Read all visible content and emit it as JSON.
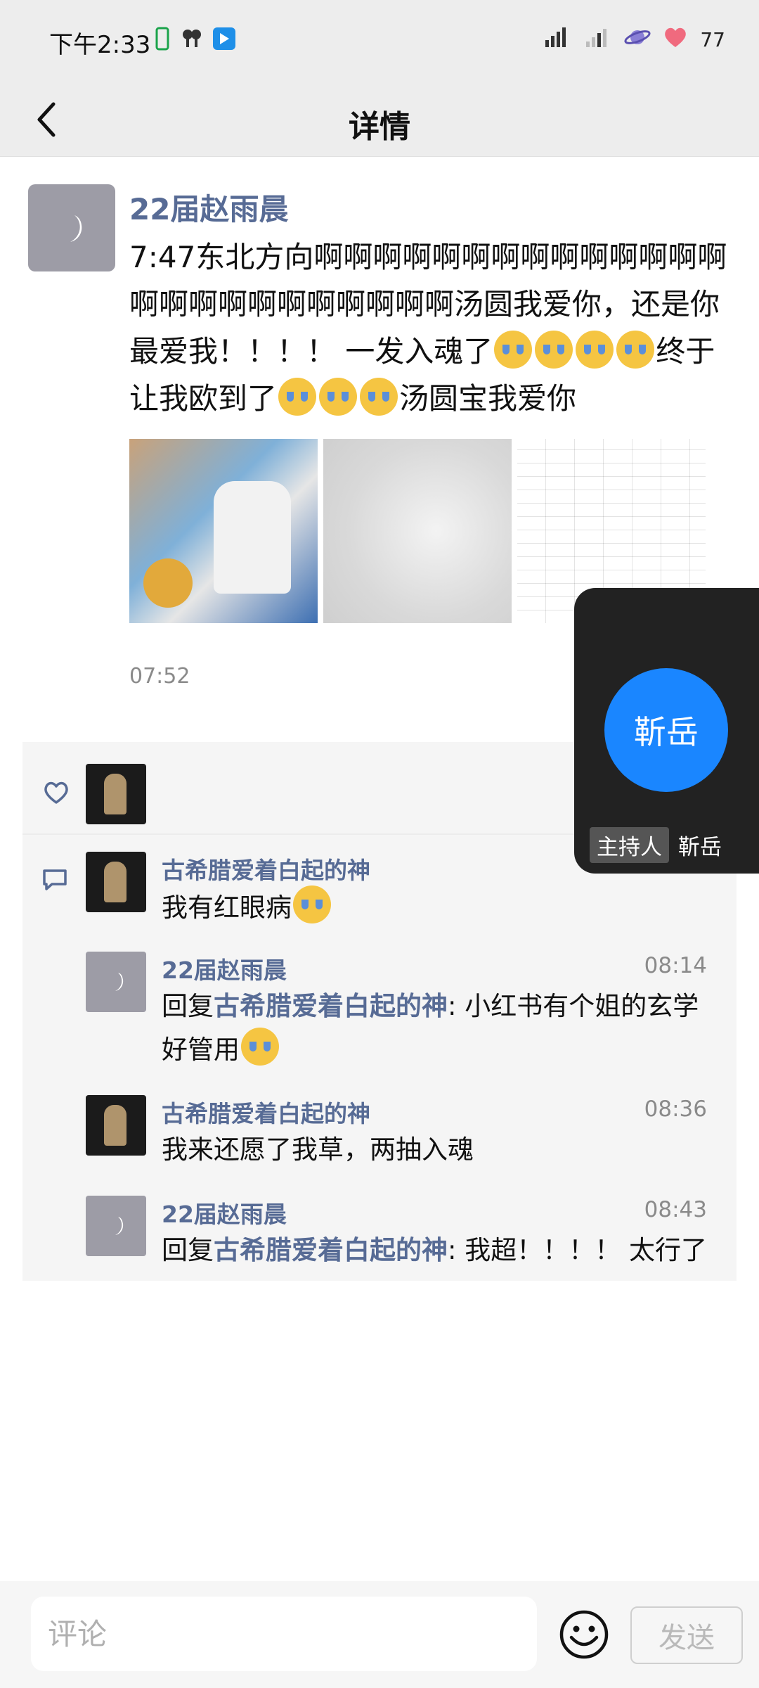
{
  "status_bar": {
    "time": "下午2:33",
    "battery": "77"
  },
  "header": {
    "title": "详情"
  },
  "post": {
    "author": "22届赵雨晨",
    "text_parts": [
      "7:47东北方向啊啊啊啊啊啊啊啊啊啊啊啊啊啊啊啊啊啊啊啊啊啊啊啊啊汤圆我爱你，还是你最爱我！！！！ 一发入魂了",
      "终于让我欧到了",
      "汤圆宝我爱你"
    ],
    "time": "07:52"
  },
  "comments": [
    {
      "name": "古希腊爱着白起的神",
      "time": "",
      "text": "我有红眼病",
      "reply_to": "",
      "avatar": "dark"
    },
    {
      "name": "22届赵雨晨",
      "time": "08:14",
      "reply_prefix": "回复",
      "reply_to": "古希腊爱着白起的神",
      "text": ": 小红书有个姐的玄学好管用",
      "avatar": "moon"
    },
    {
      "name": "古希腊爱着白起的神",
      "time": "08:36",
      "text": "我来还愿了我草，两抽入魂",
      "reply_to": "",
      "avatar": "dark"
    },
    {
      "name": "22届赵雨晨",
      "time": "08:43",
      "reply_prefix": "回复",
      "reply_to": "古希腊爱着白起的神",
      "text": ": 我超！！！！ 太行了",
      "avatar": "moon"
    }
  ],
  "host_card": {
    "avatar_text": "靳岳",
    "role": "主持人",
    "name": "靳岳"
  },
  "input": {
    "placeholder": "评论",
    "send_label": "发送"
  },
  "colors": {
    "link": "#576b95",
    "host_blue": "#1a86ff",
    "bar_bg": "#ededed"
  }
}
